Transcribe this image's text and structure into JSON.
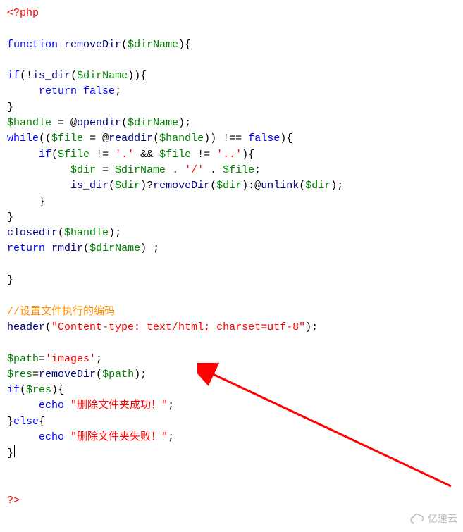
{
  "code": {
    "php_open": "<?php",
    "kw_function": "function",
    "fn_removeDir": "removeDir",
    "p_open": "(",
    "p_close": ")",
    "brace_open": "{",
    "brace_close": "}",
    "var_dirName": "$dirName",
    "var_handle": "$handle",
    "var_file": "$file",
    "var_dir": "$dir",
    "var_path": "$path",
    "var_res": "$res",
    "if": "if",
    "else": "else",
    "while": "while",
    "return": "return",
    "echo": "echo",
    "false": "false",
    "bang": "!",
    "fn_is_dir": "is_dir",
    "fn_opendir": "opendir",
    "fn_readdir": "readdir",
    "fn_closedir": "closedir",
    "fn_rmdir": "rmdir",
    "fn_unlink": "unlink",
    "fn_header": "header",
    "at": "@",
    "assign": " = ",
    "assign2": "=",
    "semi": ";",
    "ne": " != ",
    "neq": " !== ",
    "and": " && ",
    "dot": " . ",
    "tern_q": "?",
    "tern_c": ":",
    "comment_encoding": "//设置文件执行的编码",
    "str_dot": "'.'",
    "str_ddot": "'..'",
    "str_slash": "'/'",
    "str_header": "\"Content-type: text/html; charset=utf-8\"",
    "str_images": "'images'",
    "str_success": "\"删除文件夹成功！\"",
    "str_fail": "\"删除文件夹失败！\"",
    "php_close": "?>"
  },
  "watermark": "亿速云"
}
